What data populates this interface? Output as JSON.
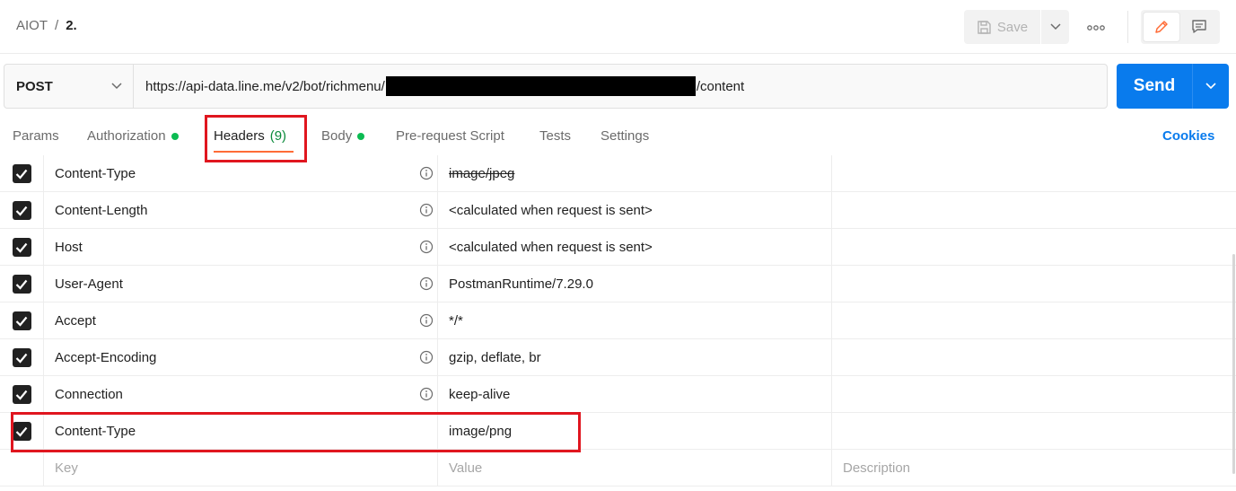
{
  "breadcrumb": {
    "root": "AIOT",
    "separator": "/",
    "current": "2."
  },
  "toolbar": {
    "save_label": "Save"
  },
  "request": {
    "method": "POST",
    "url_prefix": "https://api-data.line.me/v2/bot/richmenu/",
    "url_suffix": "/content",
    "send_label": "Send"
  },
  "tabs": [
    {
      "label": "Params"
    },
    {
      "label": "Authorization",
      "dot": true
    },
    {
      "label": "Headers",
      "count": "(9)",
      "active": true
    },
    {
      "label": "Body",
      "dot": true
    },
    {
      "label": "Pre-request Script"
    },
    {
      "label": "Tests"
    },
    {
      "label": "Settings"
    }
  ],
  "cookies_label": "Cookies",
  "headers": [
    {
      "key": "Content-Type",
      "value": "image/jpeg",
      "checked": true,
      "info": true,
      "overridden": true
    },
    {
      "key": "Content-Length",
      "value": "<calculated when request is sent>",
      "checked": true,
      "info": true
    },
    {
      "key": "Host",
      "value": "<calculated when request is sent>",
      "checked": true,
      "info": true
    },
    {
      "key": "User-Agent",
      "value": "PostmanRuntime/7.29.0",
      "checked": true,
      "info": true
    },
    {
      "key": "Accept",
      "value": "*/*",
      "checked": true,
      "info": true
    },
    {
      "key": "Accept-Encoding",
      "value": "gzip, deflate, br",
      "checked": true,
      "info": true
    },
    {
      "key": "Connection",
      "value": "keep-alive",
      "checked": true,
      "info": true
    },
    {
      "key": "Content-Type",
      "value": "image/png",
      "checked": true,
      "info": false
    }
  ],
  "placeholders": {
    "key": "Key",
    "value": "Value",
    "description": "Description"
  },
  "colors": {
    "accent": "#ff6c37",
    "send": "#097bed",
    "highlight": "#e0161f",
    "dot": "#0cbb52"
  }
}
